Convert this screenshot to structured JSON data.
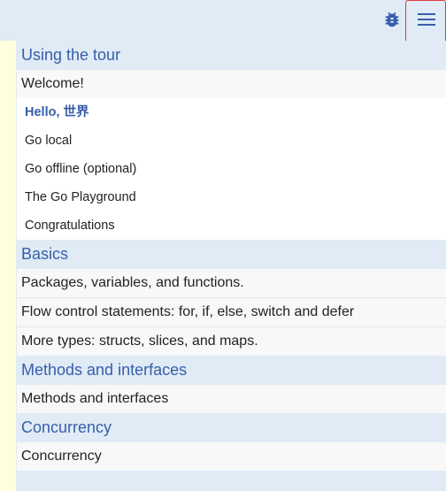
{
  "toolbar": {
    "bug_icon": "bug-icon",
    "menu_icon": "hamburger-menu-icon"
  },
  "toc": {
    "sections": [
      {
        "title": "Using the tour",
        "lessons": [
          {
            "title": "Welcome!",
            "pages": [
              "Hello, 世界",
              "Go local",
              "Go offline (optional)",
              "The Go Playground",
              "Congratulations"
            ],
            "active_page": "Hello, 世界"
          }
        ]
      },
      {
        "title": "Basics",
        "lessons": [
          {
            "title": "Packages, variables, and functions."
          },
          {
            "title": "Flow control statements: for, if, else, switch and defer"
          },
          {
            "title": "More types: structs, slices, and maps."
          }
        ]
      },
      {
        "title": "Methods and interfaces",
        "lessons": [
          {
            "title": "Methods and interfaces"
          }
        ]
      },
      {
        "title": "Concurrency",
        "lessons": [
          {
            "title": "Concurrency"
          }
        ]
      }
    ]
  },
  "colors": {
    "accent": "#375eab",
    "background": "#e0ebf5",
    "highlight_border": "#e03a3a",
    "left_strip": "#ffffe0"
  }
}
